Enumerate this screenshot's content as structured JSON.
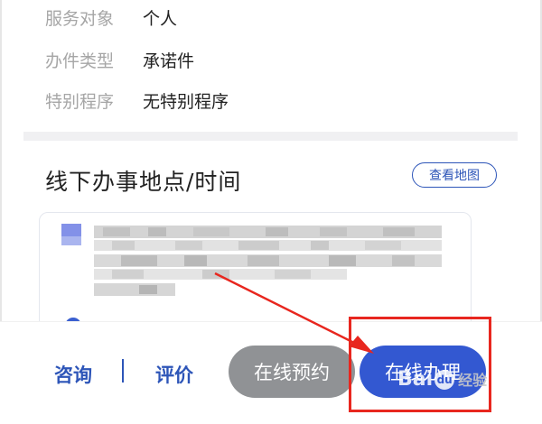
{
  "details": [
    {
      "label": "服务对象",
      "value": "个人"
    },
    {
      "label": "办件类型",
      "value": "承诺件"
    },
    {
      "label": "特别程序",
      "value": "无特别程序"
    }
  ],
  "offline": {
    "title": "线下办事地点/时间",
    "map_button": "查看地图"
  },
  "footer": {
    "consult": "咨询",
    "separator": "|",
    "evaluate": "评价",
    "appointment": "在线预约",
    "handle_online": "在线办理"
  },
  "watermark": {
    "brand_left": "Bai",
    "brand_du": "du",
    "brand_right": "经验"
  },
  "annotation_color": "#e8271f",
  "accent_color": "#3358d1"
}
